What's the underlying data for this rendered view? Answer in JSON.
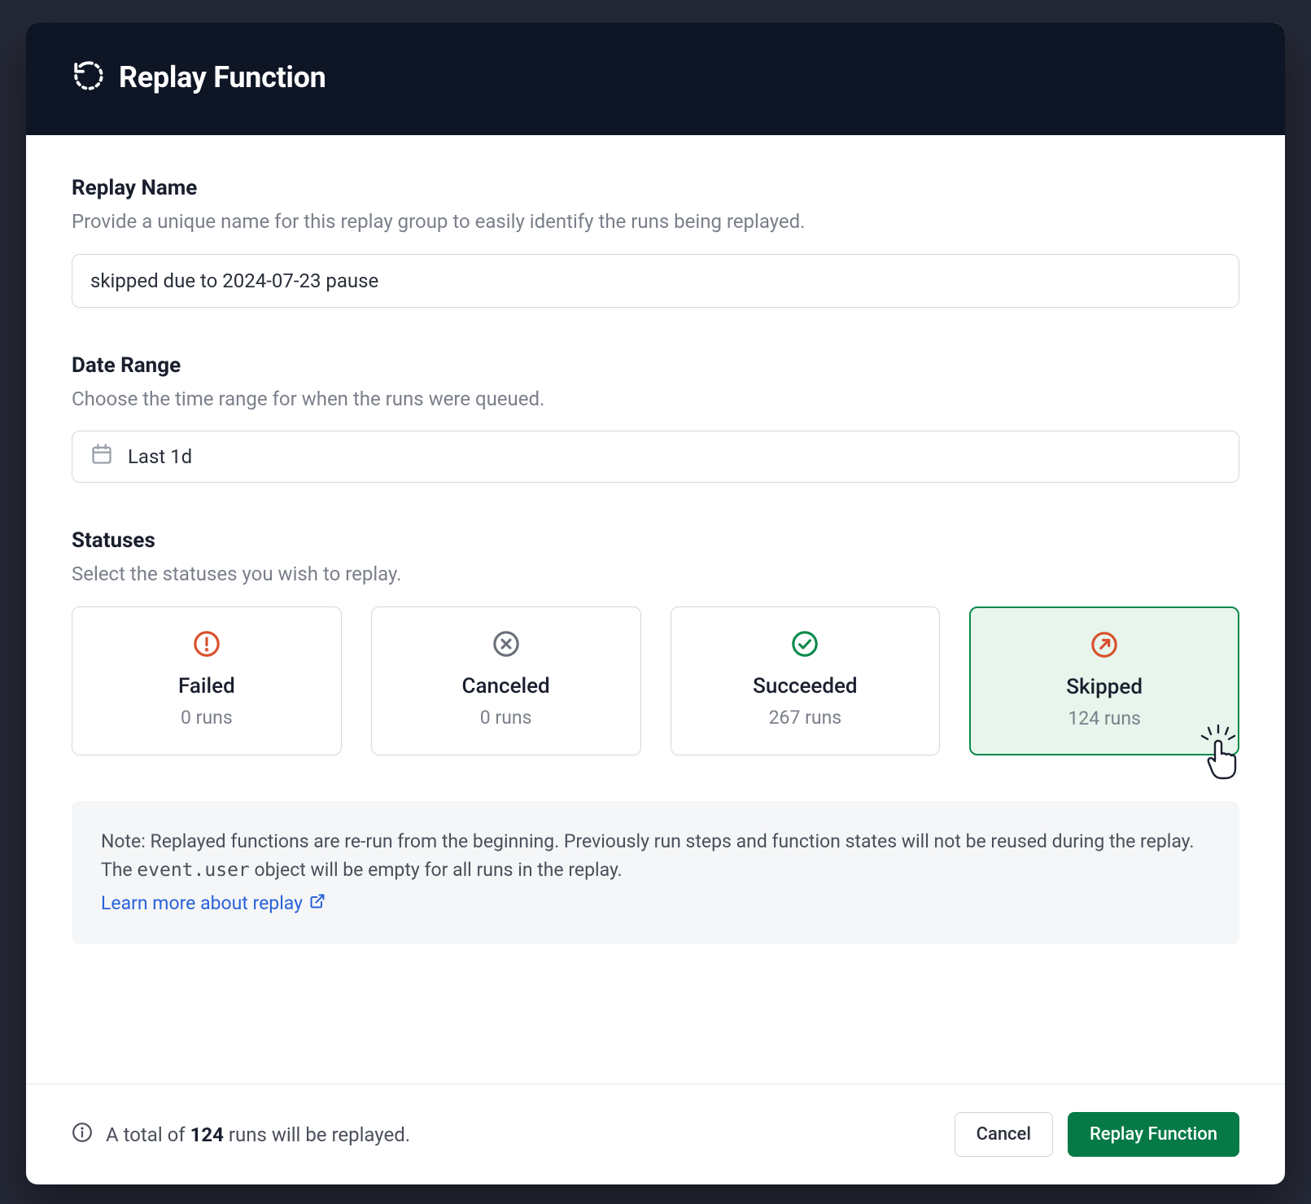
{
  "header": {
    "title": "Replay Function"
  },
  "replay_name": {
    "label": "Replay Name",
    "help": "Provide a unique name for this replay group to easily identify the runs being replayed.",
    "value": "skipped due to 2024-07-23 pause"
  },
  "date_range": {
    "label": "Date Range",
    "help": "Choose the time range for when the runs were queued.",
    "value": "Last 1d"
  },
  "statuses": {
    "label": "Statuses",
    "help": "Select the statuses you wish to replay.",
    "cards": [
      {
        "key": "failed",
        "label": "Failed",
        "count": "0 runs",
        "selected": false
      },
      {
        "key": "canceled",
        "label": "Canceled",
        "count": "0 runs",
        "selected": false
      },
      {
        "key": "succeeded",
        "label": "Succeeded",
        "count": "267 runs",
        "selected": false
      },
      {
        "key": "skipped",
        "label": "Skipped",
        "count": "124 runs",
        "selected": true
      }
    ]
  },
  "note": {
    "prefix": "Note: Replayed functions are re-run from the beginning. Previously run steps and function states will not be reused during the replay. The ",
    "code": "event.user",
    "suffix": " object will be empty for all runs in the replay.",
    "link_text": "Learn more about replay"
  },
  "footer": {
    "total_prefix": "A total of ",
    "total_count": "124",
    "total_suffix": " runs will be replayed.",
    "cancel_label": "Cancel",
    "submit_label": "Replay Function"
  },
  "colors": {
    "failed": "#d94f2b",
    "canceled": "#6a6f7a",
    "succeeded": "#0b8a4a",
    "skipped": "#d94f2b",
    "primary": "#057a47"
  }
}
